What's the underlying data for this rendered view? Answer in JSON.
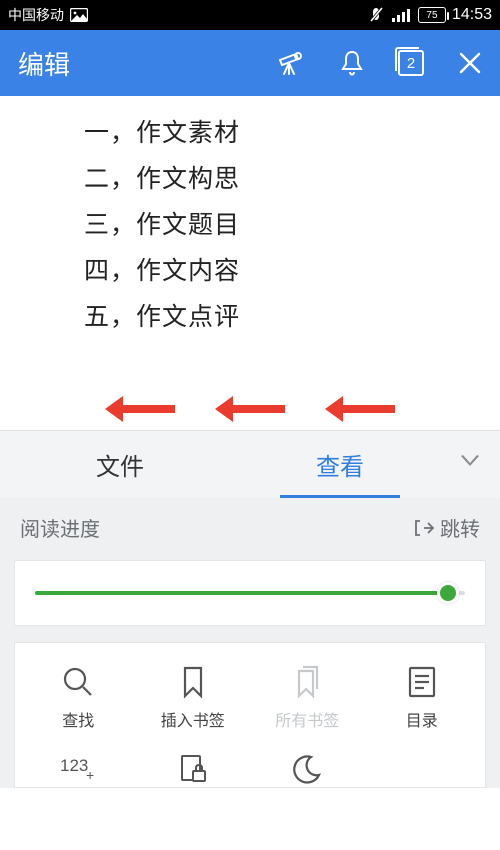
{
  "status": {
    "carrier": "中国移动",
    "battery": "75",
    "time": "14:53"
  },
  "header": {
    "title": "编辑",
    "tab_count": "2"
  },
  "document": {
    "lines": [
      "一，作文素材",
      "二，作文构思",
      "三，作文题目",
      "四，作文内容",
      "五，作文点评"
    ]
  },
  "panel": {
    "tabs": {
      "file": "文件",
      "view": "查看",
      "active": "view"
    },
    "progress": {
      "label": "阅读进度",
      "jump": "跳转",
      "percent": 96
    },
    "grid": {
      "row1": [
        {
          "key": "search",
          "label": "查找"
        },
        {
          "key": "insertbm",
          "label": "插入书签"
        },
        {
          "key": "allbm",
          "label": "所有书签"
        },
        {
          "key": "toc",
          "label": "目录"
        }
      ],
      "row2": [
        {
          "key": "count"
        },
        {
          "key": "lock"
        },
        {
          "key": "night"
        },
        {
          "key": ""
        }
      ]
    }
  },
  "colors": {
    "accent": "#3b82e6",
    "green": "#3aa83a",
    "arrow": "#e93c2e"
  }
}
